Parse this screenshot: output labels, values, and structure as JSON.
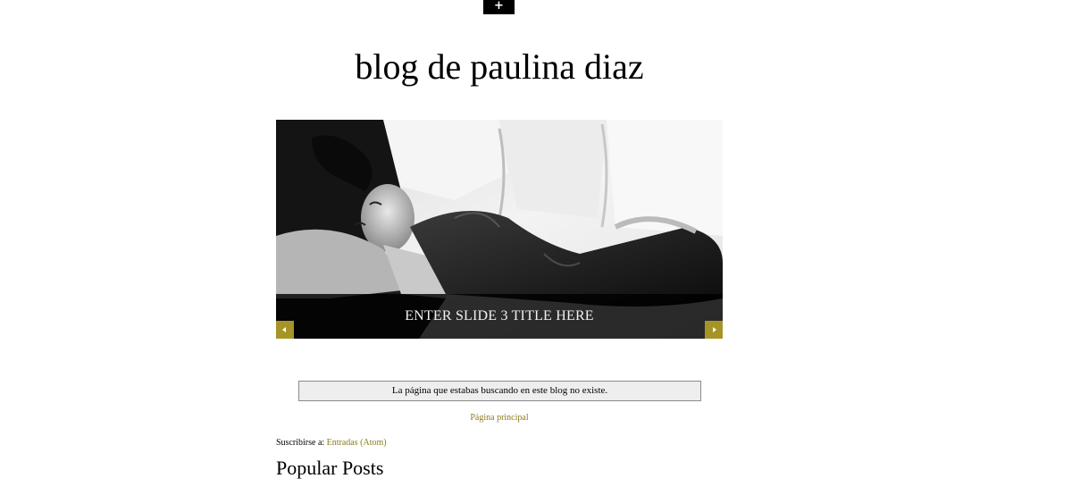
{
  "header": {
    "toggle_label": "+",
    "blog_title": "blog de paulina diaz"
  },
  "slider": {
    "slide_title": "ENTER SLIDE 3 TITLE HERE",
    "image_icon": "photo-woman-on-sofa",
    "nav_color": "#a69526",
    "prev_icon": "arrow-left-icon",
    "next_icon": "arrow-right-icon"
  },
  "main": {
    "status_message": "La página que estabas buscando en este blog no existe.",
    "home_link": "Página principal",
    "subscribe_prefix": "Suscribirse a: ",
    "subscribe_link": "Entradas (Atom)"
  },
  "sidebar": {
    "popular_posts_title": "Popular Posts"
  },
  "colors": {
    "link": "#8c7c1a",
    "accent": "#a69526",
    "status_bg": "#eeeeee"
  }
}
